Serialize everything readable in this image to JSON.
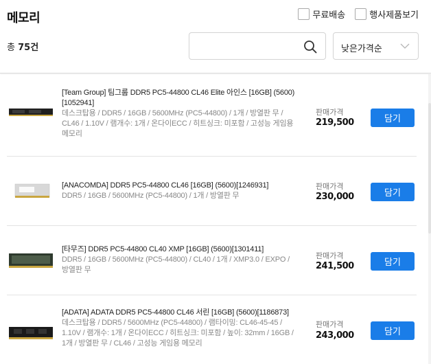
{
  "page_title": "메모리",
  "filters": [
    {
      "label": "무료배송",
      "checked": false
    },
    {
      "label": "행사제품보기",
      "checked": false
    }
  ],
  "total_prefix": "총",
  "total_count": "75건",
  "search": {
    "value": "",
    "placeholder": ""
  },
  "sort": {
    "selected": "낮은가격순"
  },
  "products": [
    {
      "title": "[Team Group] 팀그룹 DDR5 PC5-44800 CL46 Elite 아인스 [16GB] (5600) [1052941]",
      "specs": "데스크탑용 / DDR5 / 16GB / 5600MHz (PC5-44800) / 1개 / 방열판 무 / CL46 / 1.10V / 램개수: 1개 / 온다이ECC / 히트싱크: 미포함 / 고성능 게임용 메모리",
      "price_label": "판매가격",
      "price": "219,500",
      "cart_label": "담기"
    },
    {
      "title": "[ANACOMDA] DDR5 PC5-44800 CL46 [16GB] (5600)[1246931]",
      "specs": "DDR5 / 16GB / 5600MHz (PC5-44800) / 1개 / 방열판 무",
      "price_label": "판매가격",
      "price": "230,000",
      "cart_label": "담기"
    },
    {
      "title": "[타무즈] DDR5 PC5-44800 CL40 XMP [16GB] (5600)[1301411]",
      "specs": "DDR5 / 16GB / 5600MHz (PC5-44800) / CL40 / 1개 / XMP3.0 / EXPO / 방열판 무",
      "price_label": "판매가격",
      "price": "241,500",
      "cart_label": "담기"
    },
    {
      "title": "[ADATA] ADATA DDR5 PC5-44800 CL46 서린 [16GB] (5600)[1186873]",
      "specs": "데스크탑용 / DDR5 / 5600MHz (PC5-44800) / 램타이밍: CL46-45-45 / 1.10V / 램개수: 1개 / 온다이ECC / 히트싱크: 미포함 / 높이: 32mm / 16GB / 1개 / 방열판 무 / CL46 / 고성능 게임용 메모리",
      "price_label": "판매가격",
      "price": "243,000",
      "cart_label": "담기"
    }
  ],
  "colors": {
    "accent": "#1a7de8",
    "divider": "#e3e3e3",
    "muted": "#888888"
  },
  "icons": {
    "search": "search-icon",
    "sort": "chevron-down-icon",
    "thumb": "ram-stick-icon"
  }
}
